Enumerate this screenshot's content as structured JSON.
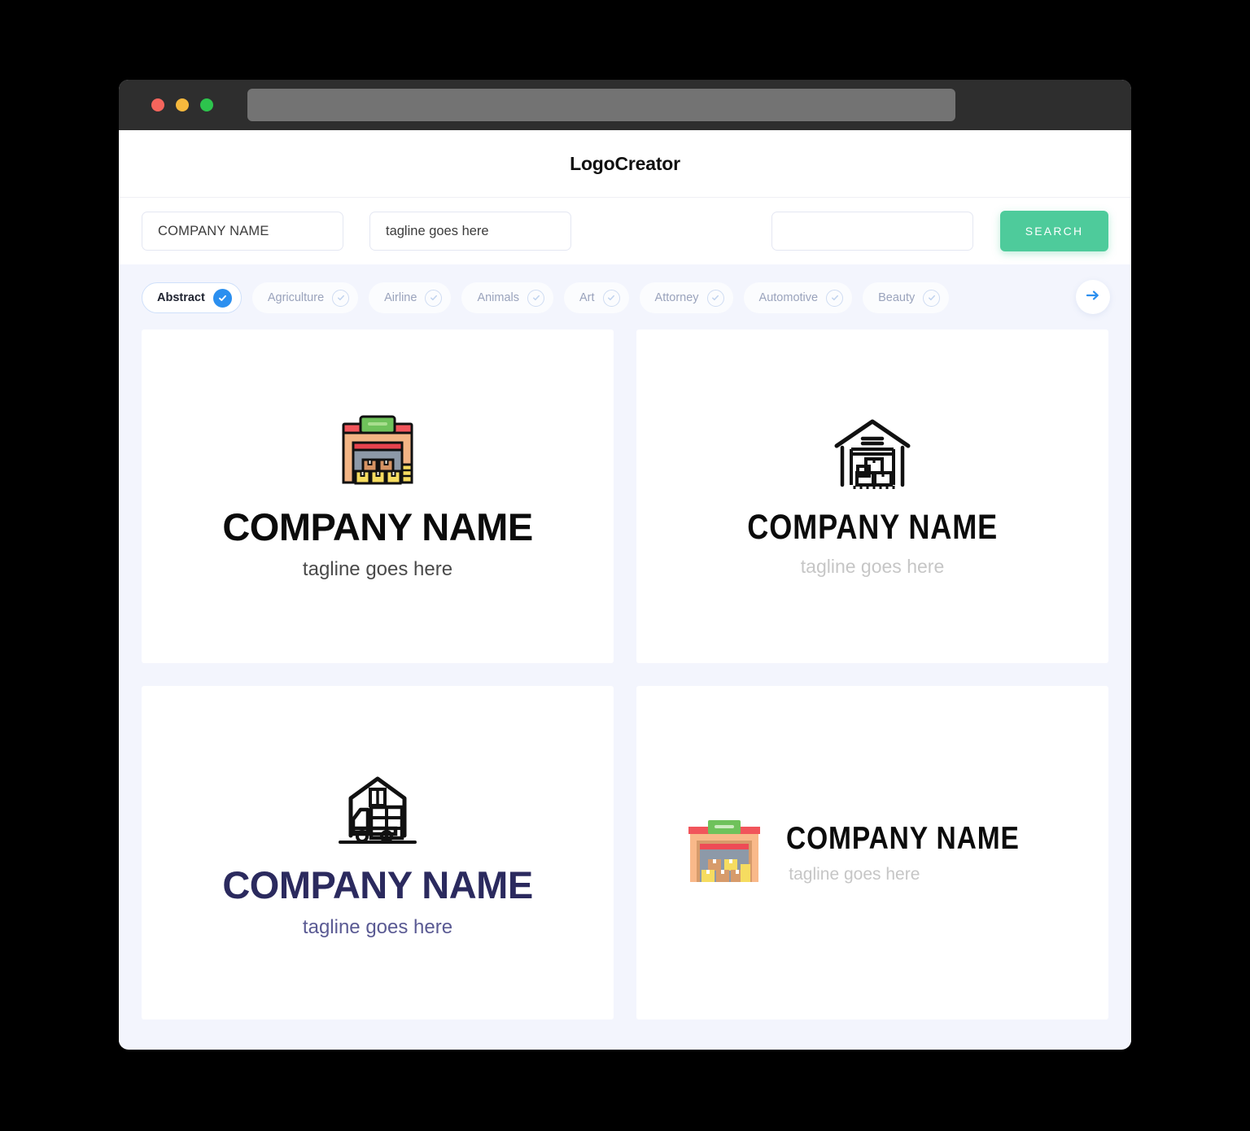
{
  "window": {
    "traffic_lights": [
      {
        "name": "close",
        "color": "#F5655C"
      },
      {
        "name": "minimize",
        "color": "#F5B83D"
      },
      {
        "name": "maximize",
        "color": "#2DC44D"
      }
    ],
    "address_bar_value": ""
  },
  "header": {
    "title": "LogoCreator"
  },
  "toolbar": {
    "company_value": "COMPANY NAME",
    "company_placeholder": "COMPANY NAME",
    "tagline_value": "tagline goes here",
    "tagline_placeholder": "tagline goes here",
    "extra_value": "",
    "extra_placeholder": "",
    "search_label": "SEARCH",
    "search_color": "#4ECB9B"
  },
  "categories": {
    "accent_color": "#2B8FEF",
    "next_icon": "arrow-right-icon",
    "items": [
      {
        "label": "Abstract",
        "selected": true
      },
      {
        "label": "Agriculture",
        "selected": false
      },
      {
        "label": "Airline",
        "selected": false
      },
      {
        "label": "Animals",
        "selected": false
      },
      {
        "label": "Art",
        "selected": false
      },
      {
        "label": "Attorney",
        "selected": false
      },
      {
        "label": "Automotive",
        "selected": false
      },
      {
        "label": "Beauty",
        "selected": false
      }
    ]
  },
  "results": [
    {
      "icon": "warehouse-color-outline-icon",
      "name": "COMPANY NAME",
      "tagline": "tagline goes here",
      "name_color": "#0B0B0B",
      "tagline_color": "#4A4A4A",
      "layout": "stacked"
    },
    {
      "icon": "warehouse-line-roof-icon",
      "name": "COMPANY NAME",
      "tagline": "tagline goes here",
      "name_color": "#0B0B0B",
      "tagline_color": "#C6C6C6",
      "layout": "stacked"
    },
    {
      "icon": "warehouse-truck-line-icon",
      "name": "COMPANY NAME",
      "tagline": "tagline goes here",
      "name_color": "#2B2A5E",
      "tagline_color": "#5A5A93",
      "layout": "stacked"
    },
    {
      "icon": "warehouse-flat-icon",
      "name": "COMPANY NAME",
      "tagline": "tagline goes here",
      "name_color": "#0B0B0B",
      "tagline_color": "#C6C6C6",
      "layout": "horizontal"
    }
  ]
}
